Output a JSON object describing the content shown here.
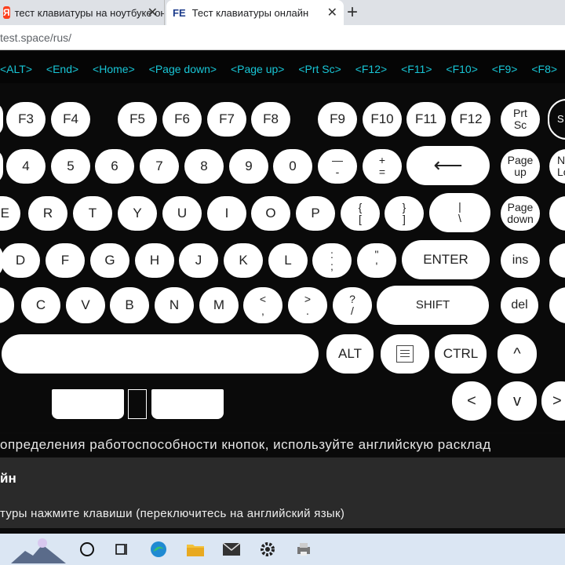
{
  "browser": {
    "tabs": [
      {
        "label": "тест клавиатуры на ноутбуке он",
        "favicon": "Я"
      },
      {
        "label": "Тест клавиатуры онлайн",
        "favicon": "FE"
      }
    ],
    "close_glyph": "✕",
    "new_tab_glyph": "+",
    "address": "test.space/rus/"
  },
  "keylog": [
    "<ALT>",
    "<End>",
    "<Home>",
    "<Page down>",
    "<Page up>",
    "<Prt Sc>",
    "<F12>",
    "<F11>",
    "<F10>",
    "<F9>",
    "<F8>"
  ],
  "keys": {
    "f3": "F3",
    "f4": "F4",
    "f5": "F5",
    "f6": "F6",
    "f7": "F7",
    "f8": "F8",
    "f9": "F9",
    "f10": "F10",
    "f11": "F11",
    "f12": "F12",
    "prtsc_top": "Prt",
    "prtsc_bottom": "Sc",
    "partial_s": "S",
    "n4": "4",
    "n5": "5",
    "n6": "6",
    "n7": "7",
    "n8": "8",
    "n9": "9",
    "n0": "0",
    "minus_top": "—",
    "minus_bottom": "-",
    "plus_top": "+",
    "plus_bottom": "=",
    "backspace": "⟵",
    "pageup_top": "Page",
    "pageup_bottom": "up",
    "partial_n": "N",
    "partial_lo": "Lo",
    "e": "E",
    "r": "R",
    "t": "T",
    "y": "Y",
    "u": "U",
    "i": "I",
    "o": "O",
    "p": "P",
    "brace_l_top": "{",
    "brace_l_bottom": "[",
    "brace_r_top": "}",
    "brace_r_bottom": "]",
    "pipe_top": "|",
    "pipe_bottom": "\\",
    "pagedown_top": "Page",
    "pagedown_bottom": "down",
    "d": "D",
    "f": "F",
    "g": "G",
    "h": "H",
    "j": "J",
    "k": "K",
    "l": "L",
    "semicolon_top": ":",
    "semicolon_bottom": ";",
    "quote_top": "\"",
    "quote_bottom": "'",
    "enter": "ENTER",
    "ins": "ins",
    "c": "C",
    "v": "V",
    "b": "B",
    "n": "N",
    "m": "M",
    "lt_top": "<",
    "lt_bottom": ",",
    "gt_top": ">",
    "gt_bottom": ".",
    "question_top": "?",
    "question_bottom": "/",
    "shift": "SHIFT",
    "del": "del",
    "alt": "ALT",
    "ctrl": "CTRL",
    "up": "^",
    "left": "<",
    "down": "v",
    "right": ">"
  },
  "hint": "определения работоспособности кнопок, используйте английскую расклад",
  "section_heading": "йн",
  "section_text": "туры нажмите клавиши (переключитесь на английский язык)"
}
